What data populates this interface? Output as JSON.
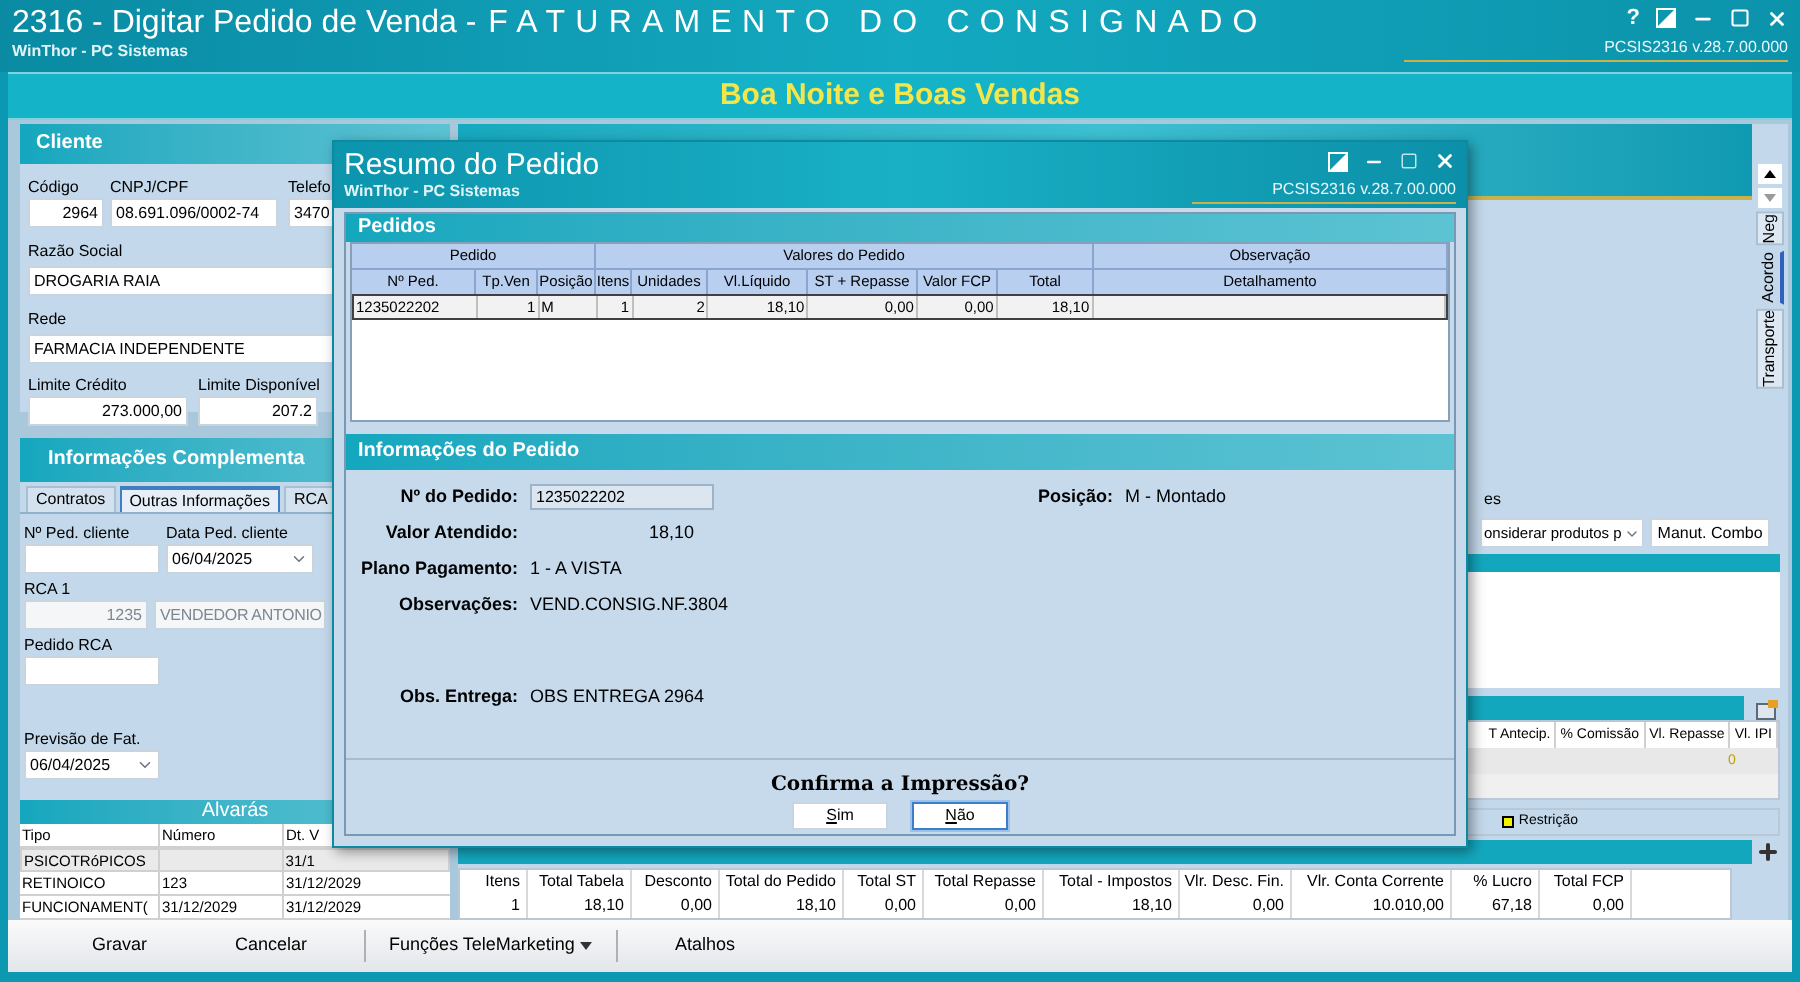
{
  "window": {
    "title": "2316 - Digitar Pedido de Venda -",
    "module": "FATURAMENTO DO CONSIGNADO",
    "subtitle": "WinThor - PC Sistemas",
    "help": "?",
    "version": "PCSIS2316  v.28.7.00.000"
  },
  "banner": "Boa Noite e Boas Vendas",
  "cliente": {
    "title": "Cliente",
    "codigo": {
      "label": "Código",
      "value": "2964"
    },
    "cnpj": {
      "label": "CNPJ/CPF",
      "value": "08.691.096/0002-74"
    },
    "telefone": {
      "label": "Telefo",
      "value": "3470"
    },
    "razao": {
      "label": "Razão Social",
      "value": "DROGARIA RAIA"
    },
    "rede": {
      "label": "Rede",
      "value": "FARMACIA INDEPENDENTE"
    },
    "limite_credito": {
      "label": "Limite Crédito",
      "value": "273.000,00"
    },
    "limite_disponivel": {
      "label": "Limite Disponível",
      "value": "207.2"
    }
  },
  "complementares": {
    "title": "Informações Complementa",
    "tabs": [
      {
        "label": "Contratos",
        "selected": false
      },
      {
        "label": "Outras Informações",
        "selected": true
      },
      {
        "label": "RCA",
        "selected": false
      }
    ],
    "ped_cliente": {
      "label": "Nº Ped. cliente"
    },
    "data_ped": {
      "label": "Data Ped. cliente",
      "value": "06/04/2025"
    },
    "rca": {
      "label": "RCA 1",
      "code": "1235",
      "name": "VENDEDOR ANTONIO",
      "disabled": true
    },
    "pedido_rca": {
      "label": "Pedido RCA"
    },
    "previsao": {
      "label": "Previsão de Fat.",
      "value": "06/04/2025"
    }
  },
  "alvaras": {
    "title": "Alvarás",
    "columns": [
      "Tipo",
      "Número",
      "Dt. V"
    ],
    "rows": [
      {
        "tipo": "PSICOTRóPICOS",
        "dt_v": "31/1",
        "selected": true
      },
      {
        "tipo": "RETINOICO",
        "numero": "123",
        "dt_v": "31/12/2029",
        "selected": false
      },
      {
        "tipo": "FUNCIONAMENT(",
        "numero": "31/12/2029",
        "dt_v": "31/12/2029",
        "selected": false
      }
    ]
  },
  "side_tabs": [
    {
      "label": "Neg",
      "selected": false
    },
    {
      "label": "Acordo",
      "selected": true
    },
    {
      "label": "Transporte",
      "selected": false
    }
  ],
  "produtos": {
    "filter_label": "es",
    "filter_value": "onsiderar produtos p",
    "combo_button": "Manut. Combo",
    "columns": [
      "T Antecip.",
      "% Comissão",
      "Vl. Repasse",
      "Vl. IPI"
    ],
    "row": {
      "vl_ipi": "0"
    },
    "legend": [
      {
        "label": "Restrição",
        "color": "#f2f200"
      }
    ]
  },
  "totals": {
    "columns": [
      "Itens",
      "Total Tabela",
      "Desconto",
      "Total do Pedido",
      "Total ST",
      "Total Repasse",
      "Total - Impostos",
      "Vlr. Desc. Fin.",
      "Vlr. Conta Corrente",
      "% Lucro",
      "Total FCP"
    ],
    "values": [
      "1",
      "18,10",
      "0,00",
      "18,10",
      "0,00",
      "0,00",
      "18,10",
      "0,00",
      "10.010,00",
      "67,18",
      "0,00"
    ]
  },
  "toolbar": [
    {
      "label": "Gravar",
      "kind": "button"
    },
    {
      "label": "Cancelar",
      "kind": "button"
    },
    {
      "label": "Funções TeleMarketing",
      "kind": "menu"
    },
    {
      "label": "Atalhos",
      "kind": "button"
    }
  ],
  "dialog": {
    "title": "Resumo do Pedido",
    "subtitle": "WinThor - PC Sistemas",
    "version": "PCSIS2316  v.28.7.00.000",
    "pedidos": {
      "title": "Pedidos",
      "groups": [
        {
          "label": "Pedido",
          "columns": [
            "Nº Ped.",
            "Tp.Ven",
            "Posição"
          ]
        },
        {
          "label": "Valores do Pedido",
          "columns": [
            "Itens",
            "Unidades",
            "Vl.Líquido",
            "ST + Repasse",
            "Valor FCP",
            "Total"
          ]
        },
        {
          "label": "Observação",
          "columns": [
            "Detalhamento"
          ]
        }
      ],
      "rows": [
        {
          "cells": [
            "1235022202",
            "1",
            "M",
            "1",
            "2",
            "18,10",
            "0,00",
            "0,00",
            "18,10"
          ],
          "selected": true
        }
      ]
    },
    "info": {
      "title": "Informações do Pedido",
      "numero": {
        "label": "Nº do Pedido:",
        "value": "1235022202"
      },
      "posicao": {
        "label": "Posição:",
        "value": "M - Montado"
      },
      "valor": {
        "label": "Valor Atendido:",
        "value": "18,10"
      },
      "plano": {
        "label": "Plano Pagamento:",
        "value": "1 - A VISTA"
      },
      "obs": {
        "label": "Observações:",
        "value": "VEND.CONSIG.NF.3804"
      },
      "entrega": {
        "label": "Obs. Entrega:",
        "value": "OBS ENTREGA 2964"
      }
    },
    "confirm": {
      "question": "Confirma a Impressão?",
      "buttons": [
        {
          "label": "Sim",
          "selected": false
        },
        {
          "label": "Não",
          "selected": true
        }
      ]
    }
  }
}
